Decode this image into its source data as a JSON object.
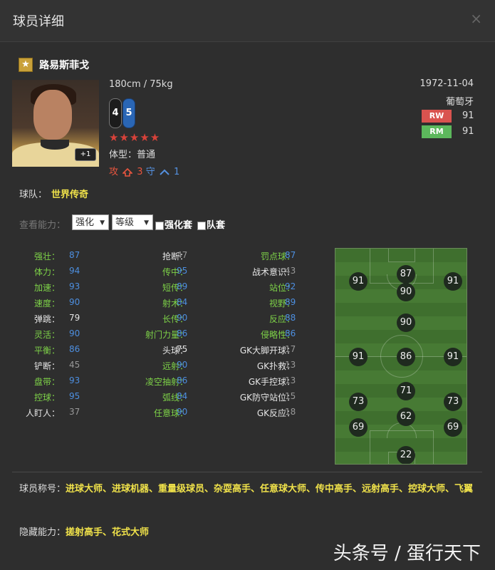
{
  "window": {
    "title": "球员详细",
    "close_icon": "×"
  },
  "player": {
    "name": "路易斯菲戈",
    "star_icon": "★",
    "height_weight": "180cm / 75kg",
    "weak_foot": "4",
    "strong_foot": "5",
    "stars": "★★★★★",
    "body_type": "体型：普通",
    "plus_badge": "+1",
    "attack_label": "攻",
    "attack_value": "3",
    "defense_label": "守",
    "defense_value": "1",
    "birth_date": "1972-11-04",
    "nationality": "葡萄牙",
    "positions": [
      {
        "pos": "RW",
        "rating": "91",
        "color": "#d9534f"
      },
      {
        "pos": "RM",
        "rating": "91",
        "color": "#5cb85c"
      }
    ]
  },
  "team": {
    "label": "球队：",
    "value": "世界传奇"
  },
  "ability_filter": {
    "label": "查看能力：",
    "select1": "强化",
    "select2": "等级",
    "check1": "强化套",
    "check2": "队套"
  },
  "stats": {
    "col1": [
      {
        "name": "强壮：",
        "value": "87",
        "name_color": "green",
        "value_color": "blue"
      },
      {
        "name": "体力：",
        "value": "94",
        "name_color": "green",
        "value_color": "blue"
      },
      {
        "name": "加速：",
        "value": "93",
        "name_color": "green",
        "value_color": "blue"
      },
      {
        "name": "速度：",
        "value": "90",
        "name_color": "green",
        "value_color": "blue"
      },
      {
        "name": "弹跳：",
        "value": "79",
        "name_color": "white",
        "value_color": "white"
      },
      {
        "name": "灵活：",
        "value": "90",
        "name_color": "green",
        "value_color": "blue"
      },
      {
        "name": "平衡：",
        "value": "86",
        "name_color": "green",
        "value_color": "blue"
      },
      {
        "name": "铲断：",
        "value": "45",
        "name_color": "white",
        "value_color": "grey"
      },
      {
        "name": "盘带：",
        "value": "93",
        "name_color": "green",
        "value_color": "blue"
      },
      {
        "name": "控球：",
        "value": "95",
        "name_color": "green",
        "value_color": "blue"
      },
      {
        "name": "人盯人：",
        "value": "37",
        "name_color": "white",
        "value_color": "grey"
      }
    ],
    "col2": [
      {
        "name": "抢断：",
        "value": "47",
        "name_color": "white",
        "value_color": "grey"
      },
      {
        "name": "传中：",
        "value": "95",
        "name_color": "green",
        "value_color": "blue"
      },
      {
        "name": "短传：",
        "value": "89",
        "name_color": "green",
        "value_color": "blue"
      },
      {
        "name": "射术：",
        "value": "84",
        "name_color": "green",
        "value_color": "blue"
      },
      {
        "name": "长传：",
        "value": "90",
        "name_color": "green",
        "value_color": "blue"
      },
      {
        "name": "射门力量：",
        "value": "86",
        "name_color": "green",
        "value_color": "blue"
      },
      {
        "name": "头球：",
        "value": "75",
        "name_color": "white",
        "value_color": "white"
      },
      {
        "name": "远射：",
        "value": "90",
        "name_color": "green",
        "value_color": "blue"
      },
      {
        "name": "凌空抽射：",
        "value": "86",
        "name_color": "green",
        "value_color": "blue"
      },
      {
        "name": "弧线：",
        "value": "84",
        "name_color": "green",
        "value_color": "blue"
      },
      {
        "name": "任意球：",
        "value": "90",
        "name_color": "green",
        "value_color": "blue"
      }
    ],
    "col3": [
      {
        "name": "罚点球：",
        "value": "87",
        "name_color": "green",
        "value_color": "blue"
      },
      {
        "name": "战术意识：",
        "value": "43",
        "name_color": "white",
        "value_color": "grey"
      },
      {
        "name": "站位：",
        "value": "92",
        "name_color": "green",
        "value_color": "blue"
      },
      {
        "name": "视野：",
        "value": "89",
        "name_color": "green",
        "value_color": "blue"
      },
      {
        "name": "反应：",
        "value": "88",
        "name_color": "green",
        "value_color": "blue"
      },
      {
        "name": "侵略性：",
        "value": "86",
        "name_color": "green",
        "value_color": "blue"
      },
      {
        "name": "GK大脚开球：",
        "value": "17",
        "name_color": "white",
        "value_color": "grey"
      },
      {
        "name": "GK扑救：",
        "value": "13",
        "name_color": "white",
        "value_color": "grey"
      },
      {
        "name": "GK手控球：",
        "value": "13",
        "name_color": "white",
        "value_color": "grey"
      },
      {
        "name": "GK防守站位：",
        "value": "15",
        "name_color": "white",
        "value_color": "grey"
      },
      {
        "name": "GK反应：",
        "value": "18",
        "name_color": "white",
        "value_color": "grey"
      }
    ]
  },
  "pitch_ratings": [
    "91",
    "87",
    "91",
    "90",
    "90",
    "91",
    "86",
    "91",
    "71",
    "73",
    "73",
    "62",
    "69",
    "69",
    "22"
  ],
  "traits": {
    "label": "球员称号：",
    "value": "进球大师、进球机器、重量级球员、杂耍高手、任意球大师、传中高手、远射高手、控球大师、飞翼"
  },
  "hidden_abilities": {
    "label": "隐藏能力：",
    "value": "搓射高手、花式大师"
  },
  "watermark": "头条号 / 蛋行天下"
}
